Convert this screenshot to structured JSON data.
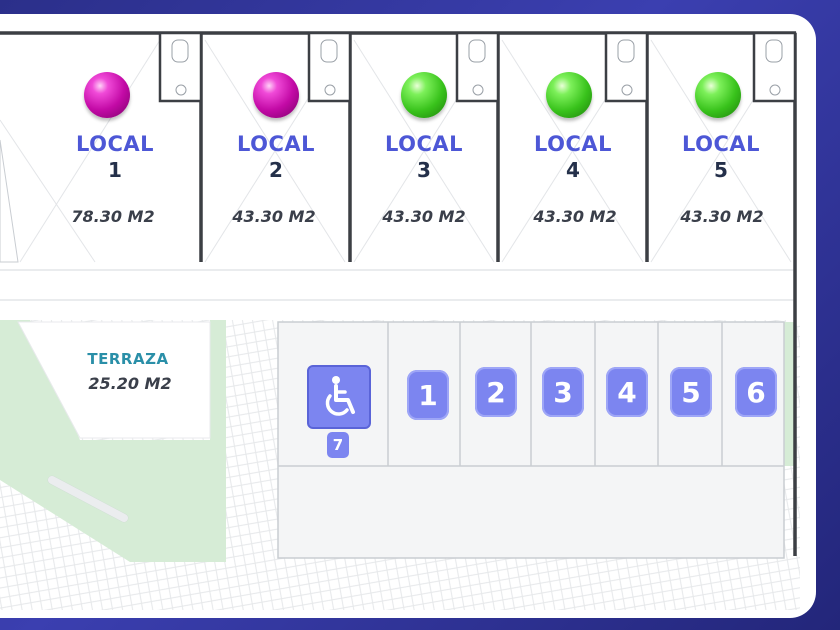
{
  "locales": [
    {
      "title": "LOCAL",
      "number": "1",
      "area": "78.30 M2",
      "status_color": "magenta"
    },
    {
      "title": "LOCAL",
      "number": "2",
      "area": "43.30 M2",
      "status_color": "magenta"
    },
    {
      "title": "LOCAL",
      "number": "3",
      "area": "43.30 M2",
      "status_color": "green"
    },
    {
      "title": "LOCAL",
      "number": "4",
      "area": "43.30 M2",
      "status_color": "green"
    },
    {
      "title": "LOCAL",
      "number": "5",
      "area": "43.30 M2",
      "status_color": "green"
    }
  ],
  "terraza": {
    "title": "TERRAZA",
    "area": "25.20 M2"
  },
  "parking": {
    "accessible_spot": {
      "icon": "wheelchair-icon",
      "number": "7"
    },
    "spots": [
      "1",
      "2",
      "3",
      "4",
      "5",
      "6"
    ]
  },
  "colors": {
    "background": "#2f33a0",
    "label_blue": "#4d57d6",
    "terraza_teal": "#2a8fa8",
    "parking_badge": "#7c85f0",
    "green_area": "#d6ecd6",
    "status_magenta": "#c30aa6",
    "status_green": "#38c21b"
  }
}
